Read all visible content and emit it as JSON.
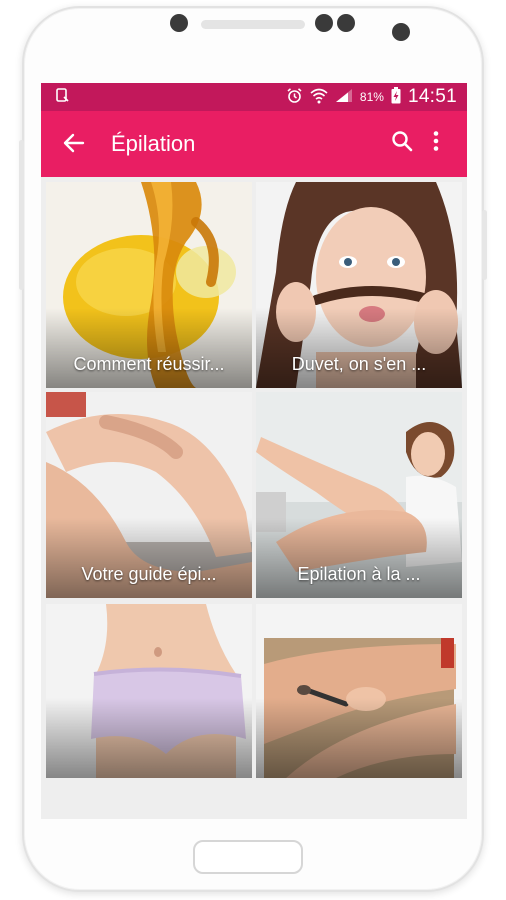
{
  "status_bar": {
    "battery_percent": "81%",
    "time": "14:51",
    "icons": [
      "screenshot-icon",
      "alarm-icon",
      "wifi-icon",
      "signal-icon",
      "battery-charging-icon"
    ]
  },
  "app_bar": {
    "title": "Épilation",
    "back_icon": "←",
    "search_icon": "⚲",
    "menu_icon": "⋮"
  },
  "colors": {
    "status_bar": "#c2185b",
    "app_bar": "#e91e63"
  },
  "articles": [
    {
      "title": "Comment réussir...",
      "image": "lemon-honey-wax"
    },
    {
      "title": "Duvet, on s'en ...",
      "image": "woman-hair-mustache"
    },
    {
      "title": "Votre guide épi...",
      "image": "bare-legs"
    },
    {
      "title": "Epilation à la ...",
      "image": "woman-shaving-legs"
    },
    {
      "title": "",
      "image": "woman-hips-underwear"
    },
    {
      "title": "",
      "image": "leg-waxing-spatula"
    }
  ]
}
